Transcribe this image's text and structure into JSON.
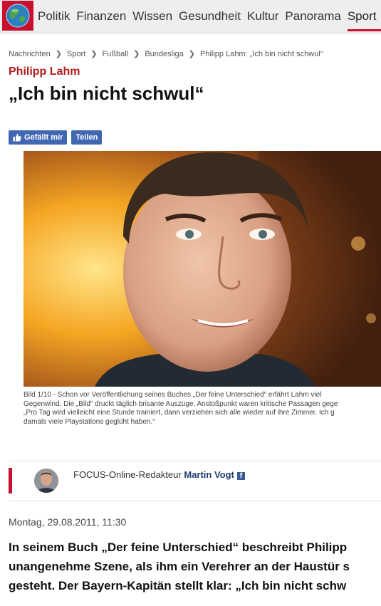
{
  "nav": {
    "items": [
      "Politik",
      "Finanzen",
      "Wissen",
      "Gesundheit",
      "Kultur",
      "Panorama",
      "Sport"
    ],
    "active": "Sport"
  },
  "breadcrumb": [
    "Nachrichten",
    "Sport",
    "Fußball",
    "Bundesliga",
    "Philipp Lahm: „Ich bin nicht schwul“"
  ],
  "article": {
    "kicker": "Philipp Lahm",
    "headline": "„Ich bin nicht schwul“",
    "like_label": "Gefällt mir",
    "share_label": "Teilen",
    "caption_lines": [
      "Bild 1/10 - Schon vor Veröffentlichung seines Buches „Der feine Unterschied“ erfährt Lahm viel",
      "Gegenwind. Die „Bild“ druckt täglich brisante Auszüge. Anstoßpunkt waren kritische Passagen gege",
      "„Pro Tag wird vielleicht eine Stunde trainiert, dann verziehen sich alle wieder auf ihre Zimmer. Ich g",
      "damals viele Playstations geglüht haben.“"
    ],
    "author_prefix": "FOCUS-Online-Redakteur",
    "author_name": "Martin Vogt",
    "date": "Montag, 29.08.2011, 11:30",
    "lead_lines": [
      "In seinem Buch „Der feine Unterschied“ beschreibt Philipp",
      "unangenehme Szene, als ihm ein Verehrer an der Haustür s",
      "gesteht. Der Bayern-Kapitän stellt klar: „Ich bin nicht schw"
    ]
  },
  "colors": {
    "accent": "#c8102e",
    "facebook": "#4267b2",
    "author_link": "#1f3a6e"
  }
}
